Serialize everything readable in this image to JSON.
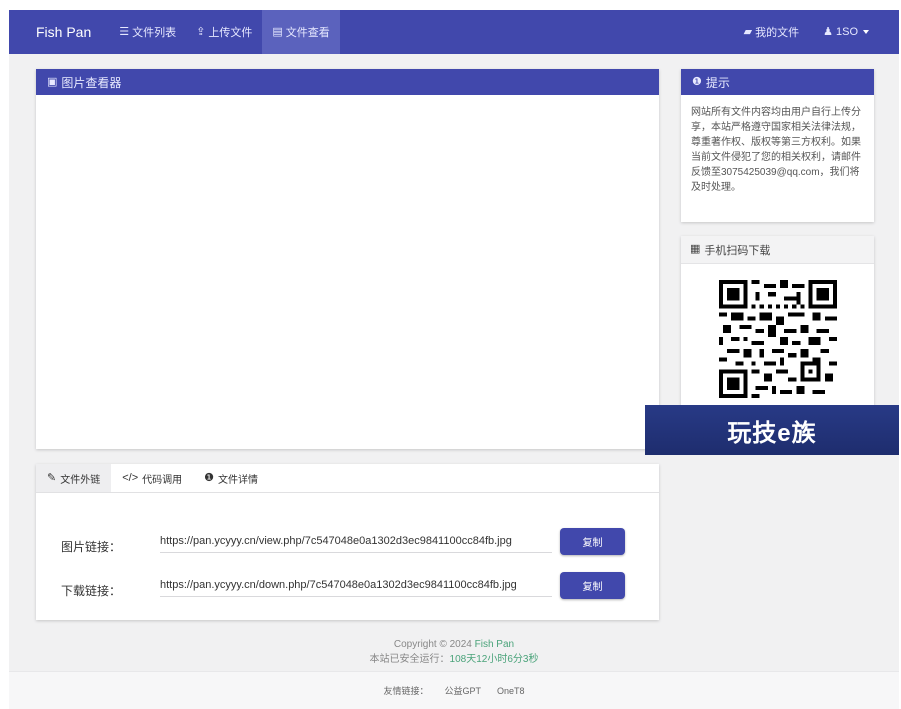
{
  "nav": {
    "brand": "Fish Pan",
    "items": [
      {
        "label": "文件列表",
        "icon": "list-icon"
      },
      {
        "label": "上传文件",
        "icon": "upload-icon"
      },
      {
        "label": "文件查看",
        "icon": "file-icon",
        "active": true
      }
    ],
    "my_files": "我的文件",
    "user": "1SO"
  },
  "viewer": {
    "title": "图片查看器"
  },
  "tips": {
    "title": "提示",
    "text": "网站所有文件内容均由用户自行上传分享，本站严格遵守国家相关法律法规，尊重著作权、版权等第三方权利。如果当前文件侵犯了您的相关权利，请邮件反馈至3075425039@qq.com，我们将及时处理。"
  },
  "qr": {
    "title": "手机扫码下载"
  },
  "watermark": {
    "text": "玩技e族"
  },
  "tabs": [
    {
      "label": "文件外链",
      "icon": "link-icon"
    },
    {
      "label": "代码调用",
      "icon": "code-icon"
    },
    {
      "label": "文件详情",
      "icon": "info-icon"
    }
  ],
  "links": {
    "image_label": "图片链接：",
    "image_url": "https://pan.ycyyy.cn/view.php/7c547048e0a1302d3ec9841100cc84fb.jpg",
    "download_label": "下载链接：",
    "download_url": "https://pan.ycyyy.cn/down.php/7c547048e0a1302d3ec9841100cc84fb.jpg",
    "copy_label": "复制"
  },
  "footer": {
    "copyright_prefix": "Copyright © 2024",
    "brand": "Fish Pan",
    "uptime_prefix": "本站已安全运行：",
    "uptime": "108天12小时6分3秒",
    "friends_label": "友情链接：",
    "friend_1": "公益GPT",
    "friend_2": "OneT8"
  },
  "colors": {
    "primary": "#4148ac",
    "background": "#f1f1f2",
    "accent_green": "#4aa37a"
  }
}
